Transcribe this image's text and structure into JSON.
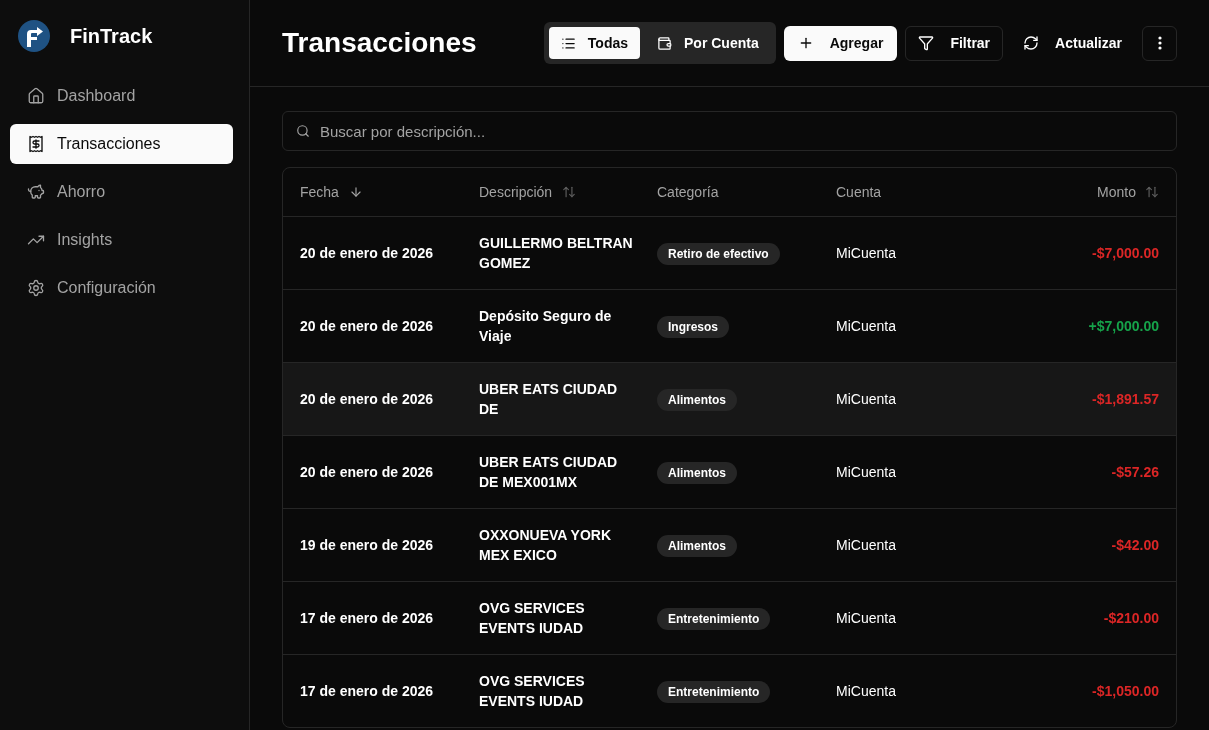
{
  "sidebar": {
    "brand": "FinTrack",
    "nav": [
      {
        "label": "Dashboard",
        "selected": false
      },
      {
        "label": "Transacciones",
        "selected": true
      },
      {
        "label": "Ahorro",
        "selected": false
      },
      {
        "label": "Insights",
        "selected": false
      },
      {
        "label": "Configuración",
        "selected": false
      }
    ]
  },
  "header": {
    "title": "Transacciones",
    "view_toggle": [
      {
        "label": "Todas",
        "selected": true
      },
      {
        "label": "Por Cuenta",
        "selected": false
      }
    ],
    "actions": [
      {
        "kind": "primary",
        "label": "Agregar"
      },
      {
        "kind": "outline",
        "label": "Filtrar"
      },
      {
        "kind": "ghost",
        "label": "Actualizar"
      },
      {
        "kind": "icon"
      }
    ]
  },
  "search": {
    "placeholder": "Buscar por descripción..."
  },
  "table": {
    "columns": [
      {
        "label": "Fecha",
        "sortable": true,
        "sorted": true
      },
      {
        "label": "Descripción",
        "sortable": true,
        "sorted": false
      },
      {
        "label": "Categoría",
        "sortable": false,
        "sorted": false
      },
      {
        "label": "Cuenta",
        "sortable": false,
        "sorted": false
      },
      {
        "label": "Monto",
        "sortable": true,
        "sorted": false
      }
    ],
    "rows": [
      {
        "date": "20 de enero de 2026",
        "description": "GUILLERMO BELTRAN GOMEZ",
        "category": "Retiro de efectivo",
        "account": "MiCuenta",
        "amount": "-$7,000.00",
        "color": "#dc2626",
        "hovered": false
      },
      {
        "date": "20 de enero de 2026",
        "description": "Depósito Seguro de Viaje",
        "category": "Ingresos",
        "account": "MiCuenta",
        "amount": "+$7,000.00",
        "color": "#16a34a",
        "hovered": false
      },
      {
        "date": "20 de enero de 2026",
        "description": "UBER EATS CIUDAD DE",
        "category": "Alimentos",
        "account": "MiCuenta",
        "amount": "-$1,891.57",
        "color": "#dc2626",
        "hovered": true
      },
      {
        "date": "20 de enero de 2026",
        "description": "UBER EATS CIUDAD DE MEX001MX",
        "category": "Alimentos",
        "account": "MiCuenta",
        "amount": "-$57.26",
        "color": "#dc2626",
        "hovered": false
      },
      {
        "date": "19 de enero de 2026",
        "description": "OXXONUEVA YORK MEX EXICO",
        "category": "Alimentos",
        "account": "MiCuenta",
        "amount": "-$42.00",
        "color": "#dc2626",
        "hovered": false
      },
      {
        "date": "17 de enero de 2026",
        "description": "OVG SERVICES EVENTS IUDAD",
        "category": "Entretenimiento",
        "account": "MiCuenta",
        "amount": "-$210.00",
        "color": "#dc2626",
        "hovered": false
      },
      {
        "date": "17 de enero de 2026",
        "description": "OVG SERVICES EVENTS IUDAD",
        "category": "Entretenimiento",
        "account": "MiCuenta",
        "amount": "-$1,050.00",
        "color": "#dc2626",
        "hovered": false
      }
    ]
  }
}
